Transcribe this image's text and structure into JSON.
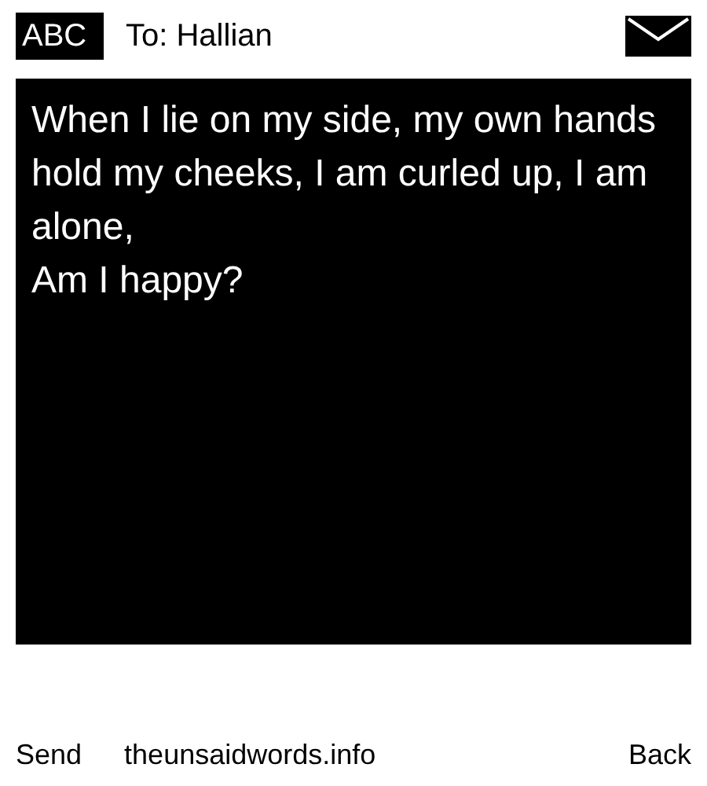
{
  "header": {
    "input_mode": "ABC",
    "recipient": "To: Hallian"
  },
  "message": {
    "lines": [
      "When I lie on my side, my own hands hold my cheeks, I am curled up, I am alone,",
      "Am I happy?"
    ]
  },
  "softkeys": {
    "left": "Send",
    "center": "theunsaidwords.info",
    "right": "Back"
  }
}
